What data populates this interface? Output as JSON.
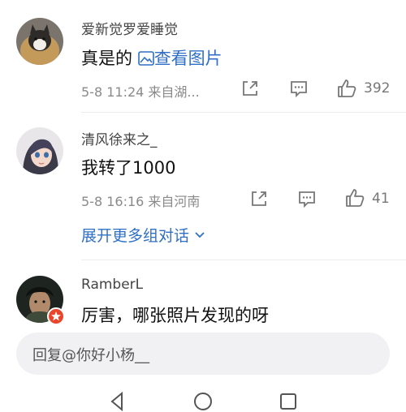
{
  "comments": [
    {
      "username": "爱新觉罗爱睡觉",
      "text": "真是的",
      "link_label": "查看图片",
      "time_location": "5-8 11:24  来自湖...",
      "likes": "392"
    },
    {
      "username": "清风徐来之_",
      "text": "我转了1000",
      "time_location": "5-8 16:16  来自河南",
      "likes": "41",
      "expand_label": "展开更多组对话"
    },
    {
      "username": "RamberL",
      "text": "厉害，哪张照片发现的呀"
    }
  ],
  "reply": {
    "placeholder": "回复@你好小杨__"
  },
  "icons": {
    "share": "share-icon",
    "comment": "comment-icon",
    "like": "thumbs-up-icon",
    "image": "image-icon",
    "chevron": "chevron-down-icon",
    "nav_back": "back-icon",
    "nav_home": "home-icon",
    "nav_recent": "recent-apps-icon"
  },
  "colors": {
    "link": "#2f6fc6",
    "badge": "#e8452b"
  }
}
